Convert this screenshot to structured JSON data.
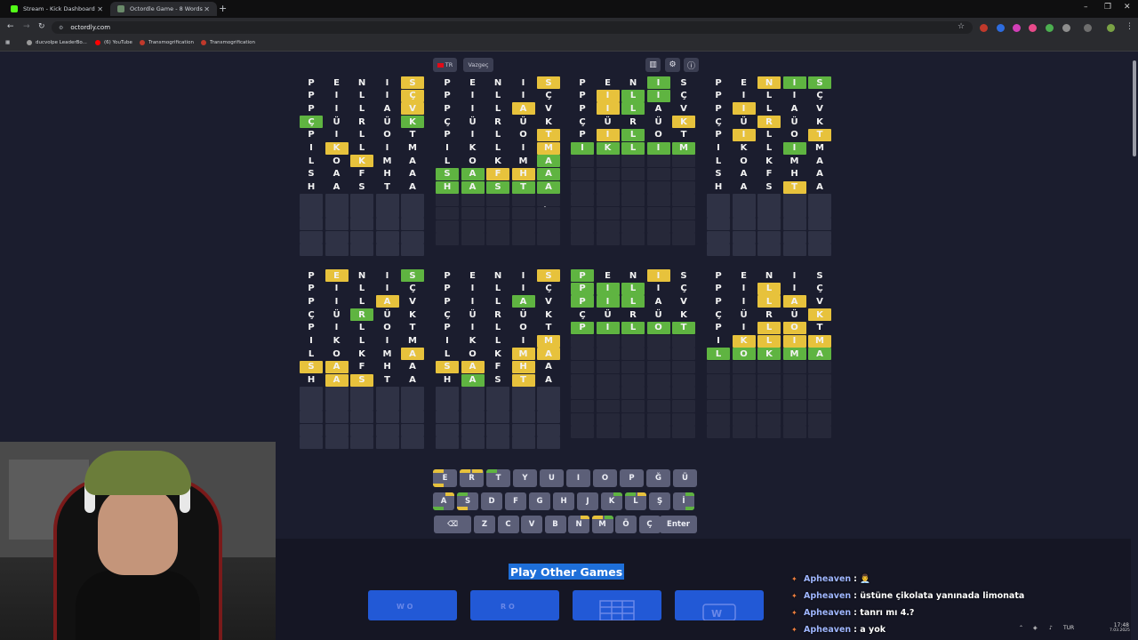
{
  "browser": {
    "tabs": [
      {
        "title": "Stream - Kick Dashboard",
        "favicon_color": "#53fc18",
        "active": false
      },
      {
        "title": "Octordle Game - 8 Words Wor...",
        "favicon_color": "#6a8a6a",
        "active": true
      }
    ],
    "url": "octordly.com",
    "bookmarks": [
      {
        "label": "ducvolpe LeaderBo...",
        "color": "#9a9a9a"
      },
      {
        "label": "(6) YouTube",
        "color": "#ff0000"
      },
      {
        "label": "Transmogrification",
        "color": "#c0392b"
      },
      {
        "label": "Transmogrification",
        "color": "#c0392b"
      }
    ]
  },
  "game": {
    "lang_label": "TR",
    "giveup_label": "Vazgeç",
    "icons": [
      "stats-icon",
      "settings-icon",
      "info-icon"
    ],
    "guesses": [
      "PENIS",
      "PILIÇ",
      "PILAV",
      "ÇÜRÜK",
      "PILOT",
      "IKLIM",
      "LOKMA",
      "SAFHA",
      "HASTA"
    ],
    "boards": [
      {
        "rows": [
          "....y",
          "....y",
          "....y",
          "g...g",
          ".....",
          ".y...",
          "..y..",
          ".....",
          "....."
        ],
        "solved": false
      },
      {
        "rows": [
          "....y",
          ".....",
          "...y.",
          ".....",
          "....y",
          "....y",
          "....g",
          "ggyyg",
          "ggggg"
        ],
        "solved": true
      },
      {
        "rows": [
          "...g.",
          ".ygg.",
          ".yg..",
          "....y",
          ".yg..",
          "ggggg"
        ],
        "solved": true
      },
      {
        "rows": [
          "..ygg",
          ".....",
          ".y...",
          "..y..",
          ".y..y",
          "...g.",
          ".....",
          ".....",
          "...y."
        ],
        "solved": false
      },
      {
        "rows": [
          ".y..g",
          ".....",
          "...y.",
          "..g..",
          ".....",
          ".....",
          "....y",
          "yy...",
          ".yy.."
        ],
        "solved": false
      },
      {
        "rows": [
          "....y",
          ".....",
          "...g.",
          ".....",
          ".....",
          "....y",
          "...yy",
          "yy.y.",
          ".g.y."
        ],
        "solved": false
      },
      {
        "rows": [
          "g..y.",
          "ggg..",
          "ggg..",
          ".....",
          "ggggg"
        ],
        "solved": true
      },
      {
        "rows": [
          ".....",
          "..y..",
          "..yy.",
          "....y",
          "..yy.",
          ".yyyy",
          "ggggg"
        ],
        "solved": true
      }
    ],
    "keyboard": {
      "row1": [
        "E",
        "R",
        "T",
        "Y",
        "U",
        "I",
        "O",
        "P",
        "Ğ",
        "Ü"
      ],
      "row2": [
        "A",
        "S",
        "D",
        "F",
        "G",
        "H",
        "J",
        "K",
        "L",
        "Ş",
        "İ"
      ],
      "row3": [
        "Z",
        "C",
        "V",
        "B",
        "N",
        "M",
        "Ö",
        "Ç"
      ],
      "enter_label": "Enter",
      "backspace_icon": "backspace-icon"
    },
    "play_other_label": "Play Other Games",
    "game_cards": [
      {
        "text": "W O"
      },
      {
        "text": "R O"
      },
      {
        "text": ""
      },
      {
        "text": ""
      }
    ]
  },
  "chat": [
    {
      "user": "Apheaven",
      "message": "👨‍💼"
    },
    {
      "user": "Apheaven",
      "message": "üstüne çikolata yanınada limonata"
    },
    {
      "user": "Apheaven",
      "message": "tanrı mı 4.?"
    },
    {
      "user": "Apheaven",
      "message": "a yok"
    }
  ],
  "tray": {
    "lang": "TUR",
    "time": "17:48",
    "date": "7.03.2025"
  },
  "colors": {
    "yellow": "#e7c23c",
    "green": "#5fb441",
    "empty": "#2f3245",
    "bg": "#1b1d2e",
    "key": "#5c5f78"
  }
}
